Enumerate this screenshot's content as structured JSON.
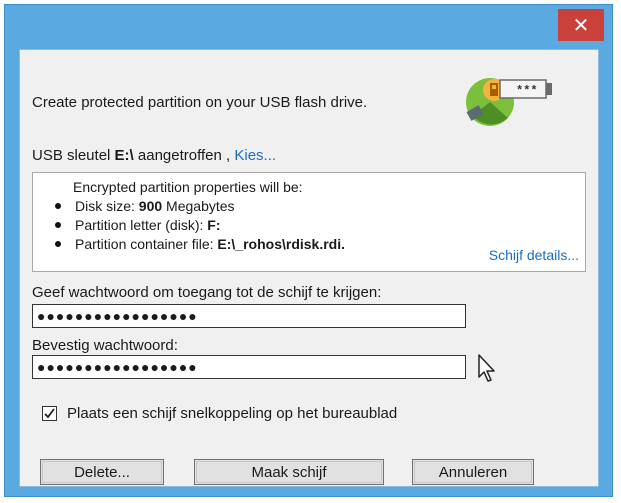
{
  "window": {
    "close_label": "✕"
  },
  "heading": "Create protected partition on your USB flash drive.",
  "usb": {
    "prefix": "USB sleutel",
    "drive": "E:\\",
    "status": "aangetroffen ,",
    "choose_link": "Kies..."
  },
  "properties": {
    "title": "Encrypted partition properties will be:",
    "items": [
      {
        "label": "Disk size:",
        "value": "900",
        "suffix": "Megabytes"
      },
      {
        "label": "Partition letter (disk):",
        "value": "F:",
        "suffix": ""
      },
      {
        "label": "Partition container file:",
        "value": "E:\\_rohos\\rdisk.rdi.",
        "suffix": ""
      }
    ],
    "details_link": "Schijf details..."
  },
  "password": {
    "label": "Geef wachtwoord om toegang tot de schijf te krijgen:",
    "value": "●●●●●●●●●●●●●●●●●",
    "confirm_label": "Bevestig wachtwoord:",
    "confirm_value": "●●●●●●●●●●●●●●●●●"
  },
  "checkbox": {
    "checked": true,
    "label": "Plaats een schijf snelkoppeling op het bureaublad"
  },
  "buttons": {
    "delete": "Delete...",
    "make": "Maak schijf",
    "cancel": "Annuleren"
  },
  "logo": {
    "icon": "rohos-disk-logo",
    "code": "***"
  },
  "colors": {
    "titlebar": "#5aa9e0",
    "close": "#c9413a",
    "link": "#1a6fc2",
    "panel": "#f0f0f0"
  }
}
